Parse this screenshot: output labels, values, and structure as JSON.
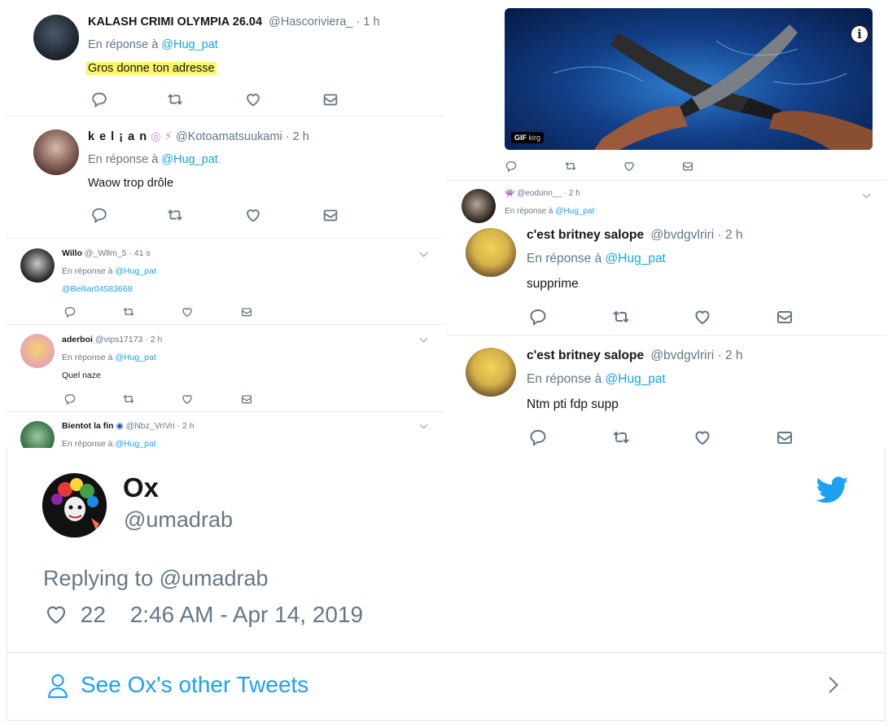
{
  "top_left": {
    "t1": {
      "name": "KALASH CRIMI OLYMPIA 26.04",
      "handle": "@Hascoriviera_",
      "time": "· 1 h",
      "reply_prefix": "En réponse à",
      "reply_to": "@Hug_pat",
      "text": "Gros donne ton adresse"
    },
    "t2": {
      "name": "k e l ¡ a n",
      "handle": "@Kotoamatsuukami",
      "time": "· 2 h",
      "reply_prefix": "En réponse à",
      "reply_to": "@Hug_pat",
      "text": "Waow trop drôle"
    }
  },
  "mid_left": {
    "t1": {
      "name": "Willo",
      "handle": "@_Wllm_5",
      "time": "· 41 s",
      "reply_prefix": "En réponse à",
      "reply_to": "@Hug_pat",
      "text": "@Belliar04583668"
    },
    "t2": {
      "name": "aderboi",
      "handle": "@vips17173",
      "time": "· 2 h",
      "reply_prefix": "En réponse à",
      "reply_to": "@Hug_pat",
      "text": "Quel naze"
    },
    "t3": {
      "name": "Bientot la fin",
      "handle": "@Nbz_VriVri",
      "time": "· 2 h",
      "reply_prefix": "En réponse à",
      "reply_to": "@Hug_pat"
    }
  },
  "top_right": {
    "gif_badge": "GIF",
    "gif_credit": "kirg",
    "small_tweet": {
      "handle": "@eodunn__",
      "time": "· 2 h",
      "reply_prefix": "En réponse à",
      "reply_to": "@Hug_pat"
    }
  },
  "mid_right": {
    "t1": {
      "name": "c'est britney salope",
      "handle": "@bvdgvlriri",
      "time": "· 2 h",
      "reply_prefix": "En réponse à",
      "reply_to": "@Hug_pat",
      "text": "supprime"
    },
    "t2": {
      "name": "c'est britney salope",
      "handle": "@bvdgvlriri",
      "time": "· 2 h",
      "reply_prefix": "En réponse à",
      "reply_to": "@Hug_pat",
      "text": "Ntm pti fdp supp"
    }
  },
  "embed": {
    "name": "Ox",
    "handle": "@umadrab",
    "replying": "Replying to @umadrab",
    "likes": "22",
    "timestamp": "2:46 AM - Apr 14, 2019",
    "see_other": "See Ox's other Tweets",
    "twitter_blue": "#1da1f2"
  },
  "icons": [
    "reply-icon",
    "retweet-icon",
    "like-icon",
    "share-icon",
    "chevron-down-icon",
    "info-icon",
    "twitter-bird-icon",
    "person-icon",
    "chevron-right-icon",
    "heart-icon"
  ]
}
